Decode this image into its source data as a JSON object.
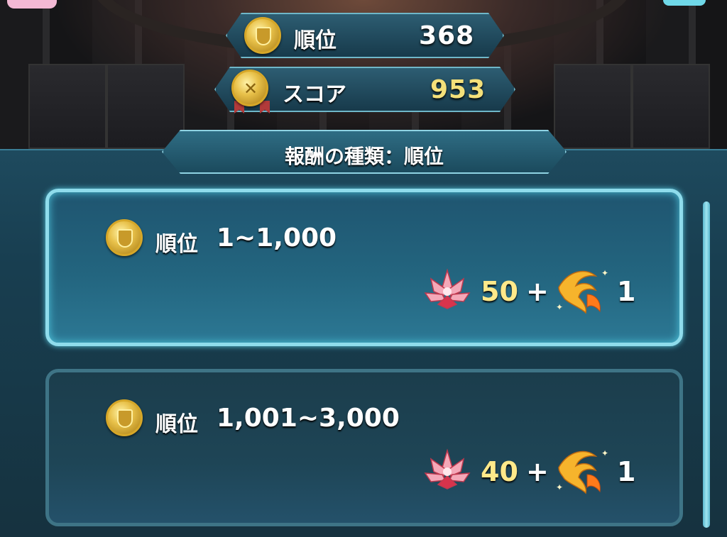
{
  "stats": {
    "rank_label": "順位",
    "rank_value": "368",
    "score_label": "スコア",
    "score_value": "953"
  },
  "header": {
    "title": "報酬の種類：順位"
  },
  "rewards": [
    {
      "rank_label": "順位",
      "range": "1~1,000",
      "orb_qty": "50",
      "plus": "+",
      "item_count": "1",
      "highlighted": true
    },
    {
      "rank_label": "順位",
      "range": "1,001~3,000",
      "orb_qty": "40",
      "plus": "+",
      "item_count": "1",
      "highlighted": false
    }
  ],
  "icons": {
    "rank_medal": "rank-medal-icon",
    "score_medal": "score-medal-icon",
    "orb": "lotus-orb-icon",
    "feather": "phoenix-feather-icon"
  },
  "colors": {
    "rank_value": "#ffffff",
    "score_value": "#f4e07a",
    "reward_qty": "#ffe98a",
    "accent_border": "#8fdcec"
  }
}
